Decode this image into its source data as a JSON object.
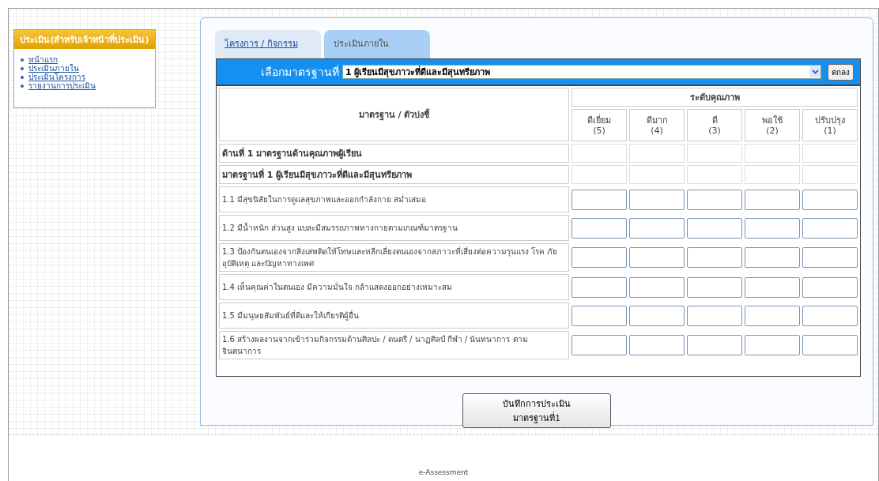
{
  "sidebar": {
    "title": "ประเมิน(สำหรับเจ้าหน้าที่ประเมิน)",
    "links": [
      "หน้าแรก",
      "ประเมินภายใน",
      "ประเมินโครงการ",
      "รายงานการประเมิน"
    ]
  },
  "tabs": [
    {
      "label": "โครงการ / กิจกรรม",
      "selected": false
    },
    {
      "label": "ประเมินภายใน",
      "selected": true
    }
  ],
  "selector": {
    "label": "เลือกมาตรฐานที่",
    "value": "1 ผู้เรียนมีสุขภาวะที่ดีและมีสุนทรียภาพ",
    "button": "ตกลง"
  },
  "table": {
    "label_header": "มาตรฐาน / ตัวบ่งชี้",
    "group_header": "ระดับคุณภาพ",
    "levels": [
      {
        "name": "ดีเยี่ยม",
        "score": "(5)"
      },
      {
        "name": "ดีมาก",
        "score": "(4)"
      },
      {
        "name": "ดี",
        "score": "(3)"
      },
      {
        "name": "พอใช้",
        "score": "(2)"
      },
      {
        "name": "ปรับปรุง",
        "score": "(1)"
      }
    ],
    "rows": [
      {
        "kind": "section",
        "text": "ด้านที่ 1 มาตรฐานด้านคุณภาพผู้เรียน"
      },
      {
        "kind": "section",
        "text": "มาตรฐานที่ 1  ผู้เรียนมีสุขภาวะที่ดีและมีสุนทรียภาพ"
      },
      {
        "kind": "indicator",
        "text": "1.1 มีสุขนิสัยในการดูแลสุขภาพและออกกำลังกาย สม่ำเสมอ"
      },
      {
        "kind": "indicator",
        "text": "1.2 มีน้ำหนัก ส่วนสูง แบละมีสมรรถภาพทางกายตามเกณฑ์มาตรฐาน"
      },
      {
        "kind": "indicator",
        "text": "1.3 ป้องกันตนเองจากสิ่งเสพติดให้โทษและหลีกเลี่ยงตนเองจากสภาวะที่เสี่ยงต่อความรุนแรง โรค ภัย อุบัติเหตุ และปัญหาทางเพศ"
      },
      {
        "kind": "indicator",
        "text": "1.4 เห็นคุณค่าในตนเอง มีความมั่นใจ  กล้าแสดงออกอย่างเหมาะสม"
      },
      {
        "kind": "indicator",
        "text": "1.5 มีมนุษยสัมพันธ์ที่ดีและให้เกียรติผู้อื่น"
      },
      {
        "kind": "indicator",
        "text": "1.6 สร้างผลงานจากเข้าร่วมกิจกรรมด้านศิลปะ / ดนตรี / นาฏศิลป์ กีฬา / นันทนาการ ตามจินตนาการ"
      }
    ]
  },
  "save_button": "บันทึกการประเมินมาตรฐานที่1",
  "footer": "e-Assessment"
}
